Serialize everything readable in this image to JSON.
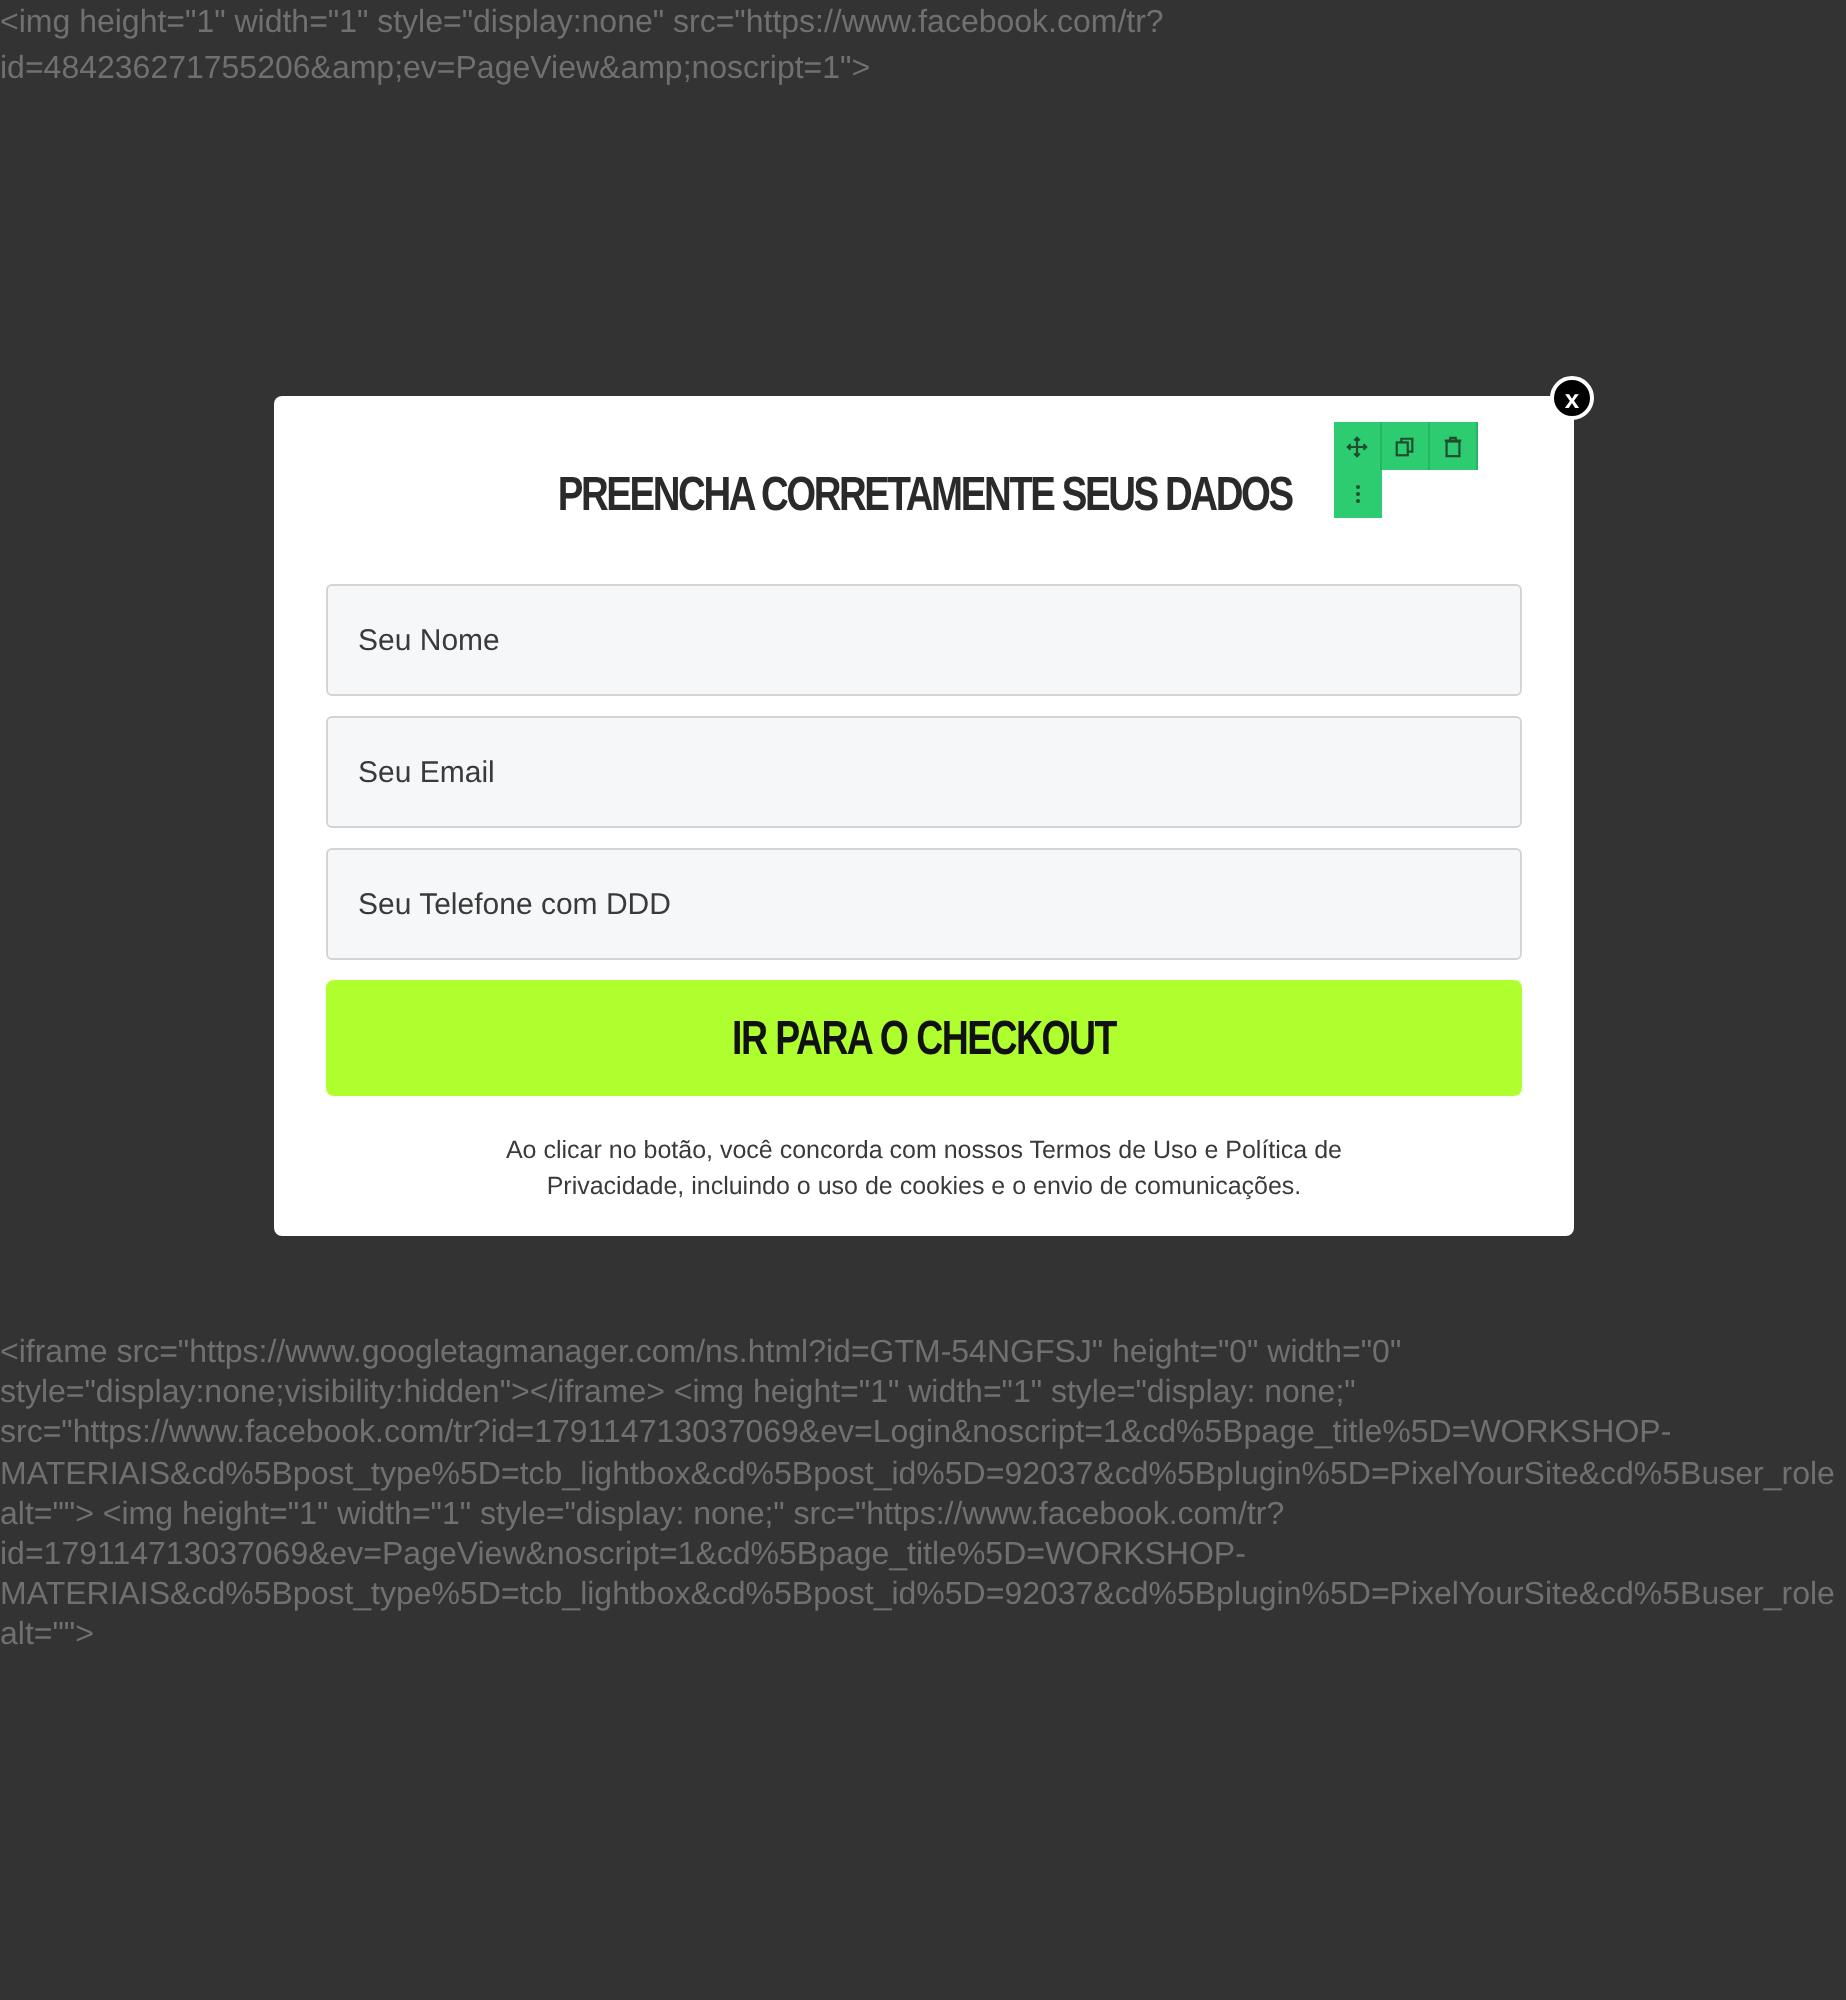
{
  "raw_text_top": [
    "<img height=\"1\" width=\"1\" style=\"display:none\" src=\"https://www.facebook.com/tr?",
    "id=484236271755206&amp;ev=PageView&amp;noscript=1\">"
  ],
  "modal": {
    "close_label": "x",
    "title": "PREENCHA CORRETAMENTE SEUS DADOS",
    "fields": [
      {
        "placeholder": "Seu Nome"
      },
      {
        "placeholder": "Seu Email"
      },
      {
        "placeholder": "Seu Telefone com DDD"
      }
    ],
    "submit_button": "IR PARA O CHECKOUT",
    "disclaimer": "Ao clicar no botão, você concorda com nossos Termos de Uso e Política de Privacidade, incluindo o uso de cookies e o envio de comunicações."
  },
  "raw_text_bottom": [
    "<iframe src=\"https://www.googletagmanager.com/ns.html?id=GTM-54NGFSJ\" height=\"0\" width=\"0\"",
    "style=\"display:none;visibility:hidden\"></iframe> <img height=\"1\" width=\"1\" style=\"display: none;\"",
    "src=\"https://www.facebook.com/tr?id=179114713037069&ev=Login&noscript=1&cd%5Bpage_title%5D=WORKSHOP-",
    "MATERIAIS&cd%5Bpost_type%5D=tcb_lightbox&cd%5Bpost_id%5D=92037&cd%5Bplugin%5D=PixelYourSite&cd%5Buser_role",
    "alt=\"\"> <img height=\"1\" width=\"1\" style=\"display: none;\" src=\"https://www.facebook.com/tr?",
    "id=179114713037069&ev=PageView&noscript=1&cd%5Bpage_title%5D=WORKSHOP-",
    "MATERIAIS&cd%5Bpost_type%5D=tcb_lightbox&cd%5Bpost_id%5D=92037&cd%5Bplugin%5D=PixelYourSite&cd%5Buser_role",
    "alt=\"\">"
  ]
}
